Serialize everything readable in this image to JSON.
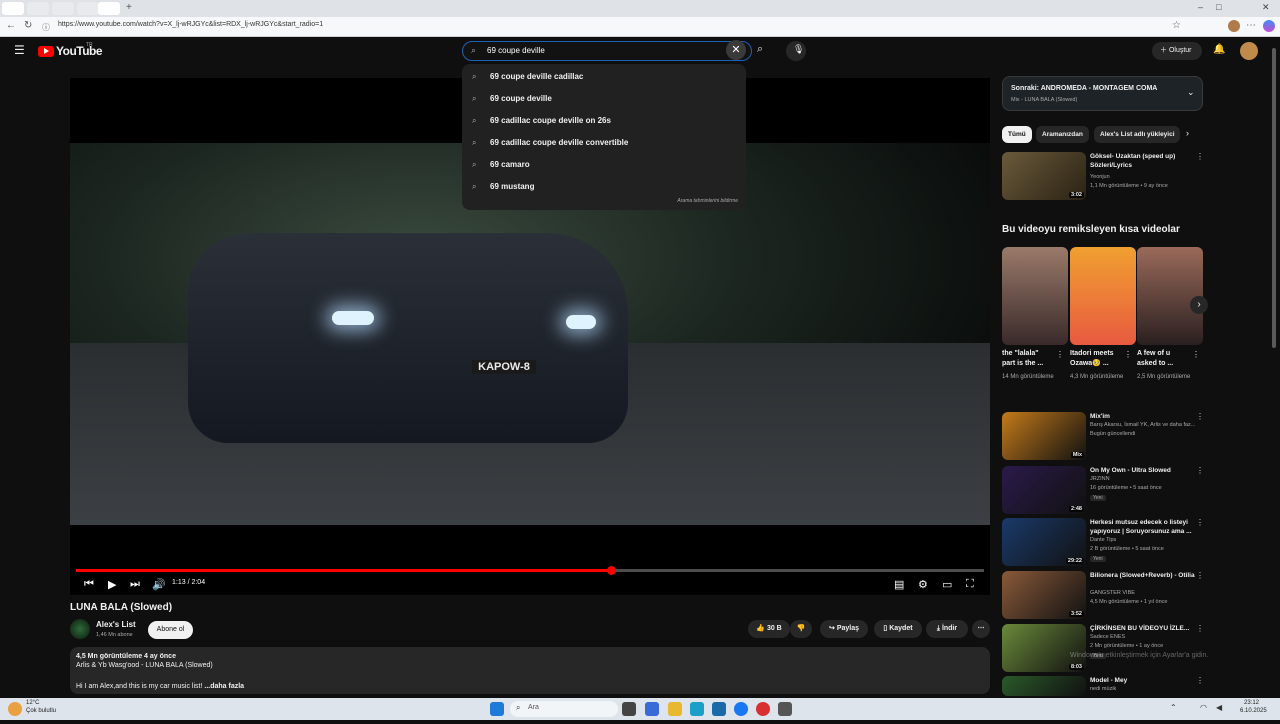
{
  "browser": {
    "url": "https://www.youtube.com/watch?v=X_lj-wRJGYc&list=RDX_lj-wRJGYc&start_radio=1"
  },
  "header": {
    "logo_text": "YouTube",
    "logo_sup": "TR",
    "search_value": "69 coupe deville",
    "create_label": "Oluştur"
  },
  "suggestions": {
    "items": [
      "69 coupe deville cadillac",
      "69 coupe deville",
      "69 cadillac coupe deville on 26s",
      "69 cadillac coupe deville convertible",
      "69 camaro",
      "69 mustang"
    ],
    "note": "Arama tahminlerini bildirme"
  },
  "player": {
    "plate": "KAPOW-8",
    "time": "1:13 / 2:04",
    "progress": 0.589
  },
  "video": {
    "title": "LUNA BALA (Slowed)",
    "channel": "Alex's List",
    "subscribers": "1,46 Mn abone",
    "subscribe_label": "Abone ol",
    "likes": "30 B",
    "share_label": "Paylaş",
    "save_label": "Kaydet",
    "download_label": "İndir",
    "desc_meta": "4,5 Mn görüntüleme  4 ay önce",
    "desc_line": "Arlis & Yb Wasg'ood - LUNA BALA (Slowed)",
    "desc_body": "Hi I am Alex,and this is my car music list! ",
    "desc_more": "...daha fazla"
  },
  "upnext": {
    "title": "Sonraki: ANDROMEDA - MONTAGEM COMA",
    "subtitle": "Mix - LUNA BALA (Slowed)"
  },
  "chips": [
    "Tümü",
    "Aramanızdan",
    "Alex's List adlı yükleyici"
  ],
  "recs_top": [
    {
      "title": "Göksel- Uzaktan (speed up) Sözleri/Lyrics",
      "channel": "Yeonjun",
      "stats": "1,1 Mn görüntüleme • 9 ay önce",
      "duration": "3:02",
      "color": "#5a4a2a"
    }
  ],
  "shorts": {
    "title": "Bu videoyu remiksleyen kısa videolar",
    "items": [
      {
        "title": "the \"lalala\" part is the ...",
        "views": "14 Mn görüntüleme"
      },
      {
        "title": "Itadori meets Ozawa🥺 ...",
        "views": "4,3 Mn görüntüleme"
      },
      {
        "title": "A few of u asked to ...",
        "views": "2,5 Mn görüntüleme"
      }
    ]
  },
  "recs": [
    {
      "title": "Mix'im",
      "channel": "Barış Akarsu, İsmail YK, Arlis ve daha faz...",
      "stats": "Bugün güncellendi",
      "duration": "Mix",
      "badge": "",
      "color": "#c47a1a"
    },
    {
      "title": "On My Own - Ultra Slowed",
      "channel": "JRZINN",
      "stats": "16 görüntüleme • 5 saat önce",
      "duration": "2:48",
      "badge": "Yeni",
      "color": "#2a1a4a"
    },
    {
      "title": "Herkesi mutsuz edecek o listeyi yapıyoruz | Soruyorsunuz ama ...",
      "channel": "Dante Tips",
      "stats": "2 B görüntüleme • 5 saat önce",
      "duration": "29:22",
      "badge": "Yeni",
      "color": "#1a3a6a"
    },
    {
      "title": "Bilionera (Slowed+Reverb) - Otilia",
      "channel": "GANGSTER VIBE",
      "stats": "4,5 Mn görüntüleme • 1 yıl önce",
      "duration": "3:52",
      "badge": "",
      "color": "#8a5a3a"
    },
    {
      "title": "ÇİRKİNSEN BU VİDEOYU İZLE...",
      "channel": "Sadece ENES",
      "stats": "2 Mn görüntüleme • 1 ay önce",
      "duration": "8:03",
      "badge": "Yeni",
      "color": "#6a8a3a"
    },
    {
      "title": "Model - Mey",
      "channel": "nedi müzik",
      "stats": "",
      "duration": "",
      "badge": "",
      "color": "#2a5a2a"
    }
  ],
  "watermark": "Windows'u etkinleştirmek için Ayarlar'a gidin.",
  "taskbar": {
    "search_placeholder": "Ara",
    "weather_temp": "12°C",
    "weather_desc": "Çok bulutlu",
    "time": "23:12",
    "date": "6.10.2025"
  }
}
